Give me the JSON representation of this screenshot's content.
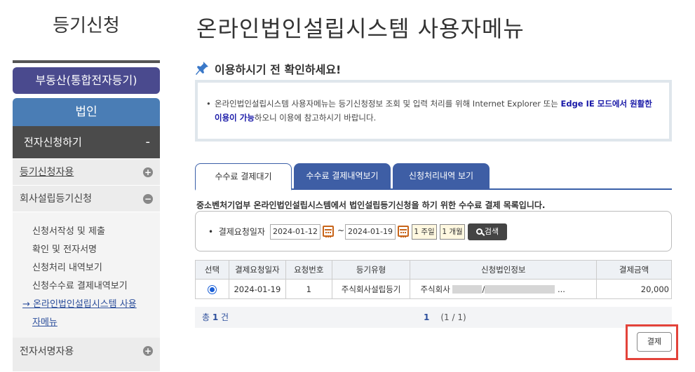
{
  "sidebar": {
    "title": "등기신청",
    "realestate_label": "부동산(통합전자등기)",
    "corp_label": "법인",
    "section_label": "전자신청하기",
    "section_toggle": "-",
    "registration_use": "등기신청자용",
    "company_label": "회사설립등기신청",
    "sub_items": [
      "신청서작성 및 제출",
      "확인 및 전자서명",
      "신청처리 내역보기",
      "신청수수료 결제내역보기"
    ],
    "active_item_line1": "→ 온라인법인설립시스템 사용",
    "active_item_line2": "자메뉴",
    "esign_label": "전자서명자용"
  },
  "main": {
    "title": "온라인법인설립시스템 사용자메뉴",
    "notice_title": "이용하시기 전 확인하세요!",
    "notice_bullet": "•",
    "notice_text_1": "온라인법인설립시스템 사용자메뉴는 등기신청정보 조회 및 입력 처리를 위해 Internet Explorer 또는 ",
    "notice_bold": "Edge IE 모드에서 원활한 이용이 가능",
    "notice_text_2": "하오니 이용에 참고하시기 바랍니다.",
    "tabs": [
      "수수료 결제대기",
      "수수료 결제내역보기",
      "신청처리내역 보기"
    ],
    "description": "중소벤처기업부 온라인법인설립시스템에서 법인설립등기신청을 하기 위한 수수료 결제 목록입니다.",
    "filter": {
      "label": "결제요청일자",
      "bullet": "•",
      "start_date": "2024-01-12",
      "tilde": "~",
      "end_date": "2024-01-19",
      "week_btn": "1 주일",
      "month_btn": "1 개월",
      "search_btn": "검색"
    },
    "table": {
      "headers": [
        "선택",
        "결제요청일자",
        "요청번호",
        "등기유형",
        "신청법인정보",
        "결제금액"
      ],
      "row": {
        "date": "2024-01-19",
        "number": "1",
        "type": "주식회사설립등기",
        "corp_prefix": "주식회사",
        "corp_sep": "/",
        "corp_suffix": "...",
        "amount": "20,000"
      }
    },
    "summary": {
      "total_prefix": "총 ",
      "total_count": "1",
      "total_suffix": " 건",
      "page_current": "1",
      "page_info": "(1 / 1)"
    },
    "pay_button": "결제"
  }
}
